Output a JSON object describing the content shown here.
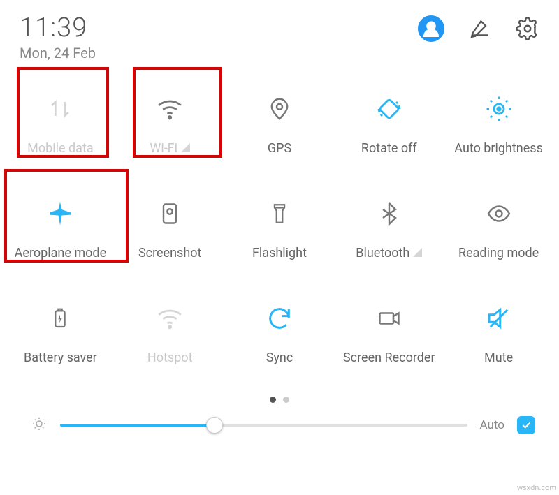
{
  "header": {
    "time": "11:39",
    "date": "Mon, 24 Feb"
  },
  "tiles": [
    {
      "id": "mobile-data",
      "label": "Mobile data",
      "state": "dim"
    },
    {
      "id": "wifi",
      "label": "Wi-Fi",
      "state": "dim"
    },
    {
      "id": "gps",
      "label": "GPS",
      "state": "off"
    },
    {
      "id": "rotate",
      "label": "Rotate off",
      "state": "on"
    },
    {
      "id": "auto-bright",
      "label": "Auto brightness",
      "state": "on"
    },
    {
      "id": "airplane",
      "label": "Aeroplane mode",
      "state": "on"
    },
    {
      "id": "screenshot",
      "label": "Screenshot",
      "state": "off"
    },
    {
      "id": "flashlight",
      "label": "Flashlight",
      "state": "off"
    },
    {
      "id": "bluetooth",
      "label": "Bluetooth",
      "state": "off"
    },
    {
      "id": "reading",
      "label": "Reading mode",
      "state": "off"
    },
    {
      "id": "battery",
      "label": "Battery saver",
      "state": "off"
    },
    {
      "id": "hotspot",
      "label": "Hotspot",
      "state": "dim"
    },
    {
      "id": "sync",
      "label": "Sync",
      "state": "on"
    },
    {
      "id": "recorder",
      "label": "Screen Recorder",
      "state": "off"
    },
    {
      "id": "mute",
      "label": "Mute",
      "state": "on"
    }
  ],
  "brightness": {
    "percent": 38,
    "auto_label": "Auto",
    "auto_checked": true
  },
  "pager": {
    "total": 2,
    "active": 0
  },
  "watermark": "wsxdn.com",
  "accent": "#29b6f6"
}
